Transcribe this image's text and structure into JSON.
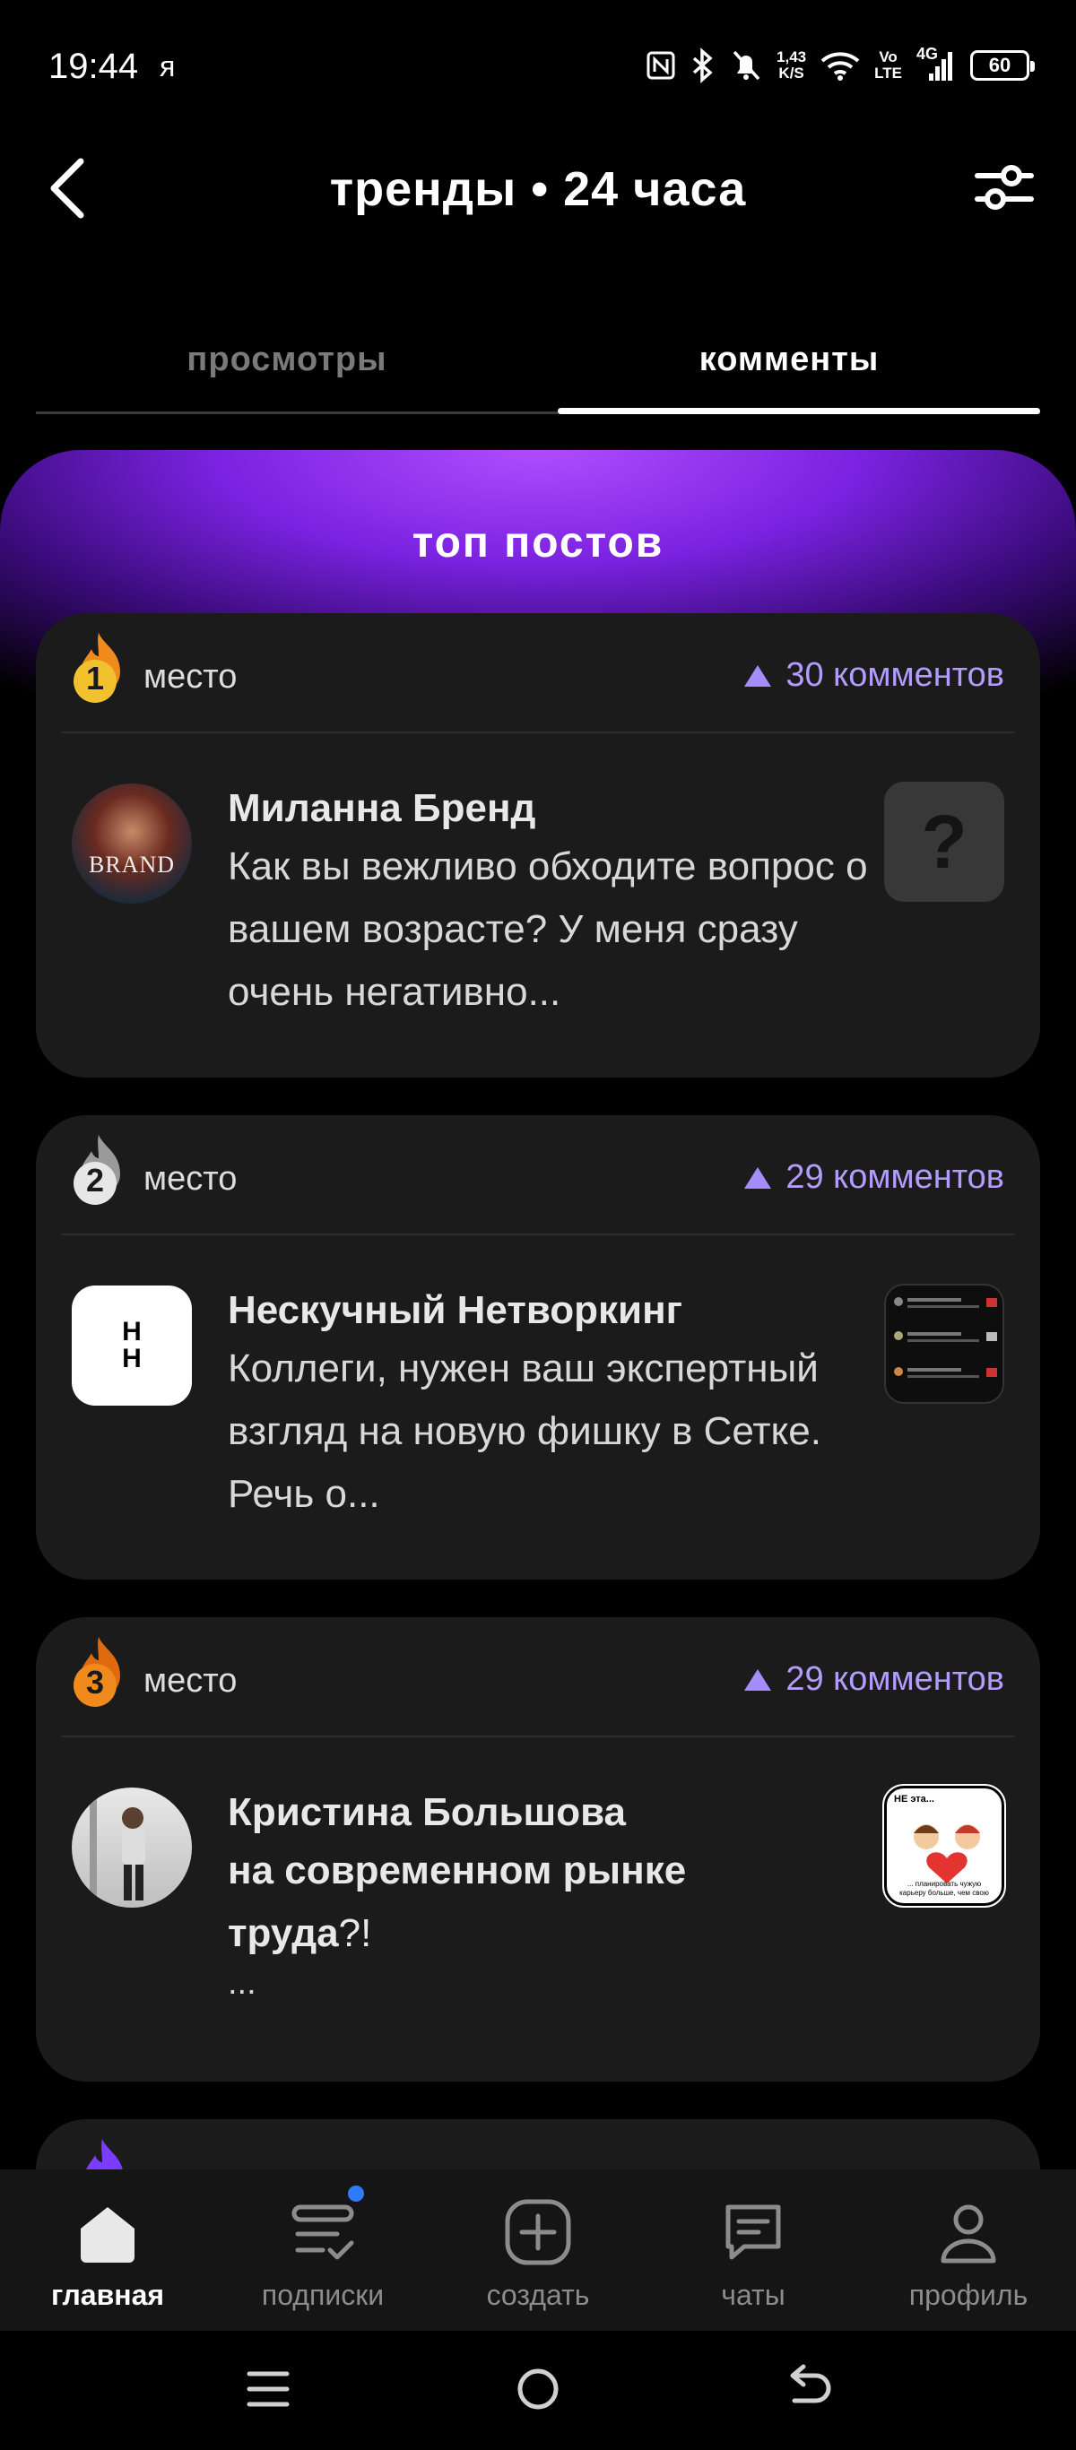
{
  "status_bar": {
    "time": "19:44",
    "carrier": "я",
    "net_speed_value": "1,43",
    "net_speed_unit": "K/S",
    "volte_top": "Vo",
    "volte_bottom": "LTE",
    "network": "4G",
    "battery": "60"
  },
  "header": {
    "title": "тренды • 24 часа"
  },
  "tabs": [
    {
      "label": "просмотры",
      "active": false
    },
    {
      "label": "комменты",
      "active": true
    }
  ],
  "banner": {
    "title": "топ постов"
  },
  "posts": [
    {
      "rank": "1",
      "rank_color": "#f2c12e",
      "place_label": "место",
      "comments": "30 комментов",
      "author": "Миланна Бренд",
      "excerpt": "Как вы вежливо обходите вопрос о вашем возрасте? У меня сразу очень негативно...",
      "avatar_text": "BRAND",
      "thumb_symbol": "?"
    },
    {
      "rank": "2",
      "rank_color": "#e6e6e6",
      "place_label": "место",
      "comments": "29 комментов",
      "author": "Нескучный Нетворкинг",
      "excerpt": "Коллеги, нужен ваш экспертный взгляд на новую фишку в Сетке. Речь о...",
      "avatar_text": "Н Н"
    },
    {
      "rank": "3",
      "rank_color": "#f08a1c",
      "place_label": "место",
      "comments": "29 комментов",
      "author": "Кристина Большова",
      "excerpt_line1": "на современном рынке",
      "excerpt_line2_bold": "труда",
      "excerpt_line2_rest": "?!",
      "excerpt_line3": "...",
      "thumb_top": "НЕ эта...",
      "thumb_bottom": "... планировать чужую карьеру больше, чем свою"
    }
  ],
  "bottom_nav": [
    {
      "label": "главная",
      "icon": "home-icon",
      "active": true
    },
    {
      "label": "подписки",
      "icon": "subscriptions-icon",
      "active": false,
      "badge": true
    },
    {
      "label": "создать",
      "icon": "create-icon",
      "active": false
    },
    {
      "label": "чаты",
      "icon": "chat-icon",
      "active": false
    },
    {
      "label": "профиль",
      "icon": "profile-icon",
      "active": false
    }
  ],
  "colors": {
    "accent": "#a58cff",
    "banner_purple": "#7a22e0",
    "card_bg": "#1b1b1b"
  }
}
